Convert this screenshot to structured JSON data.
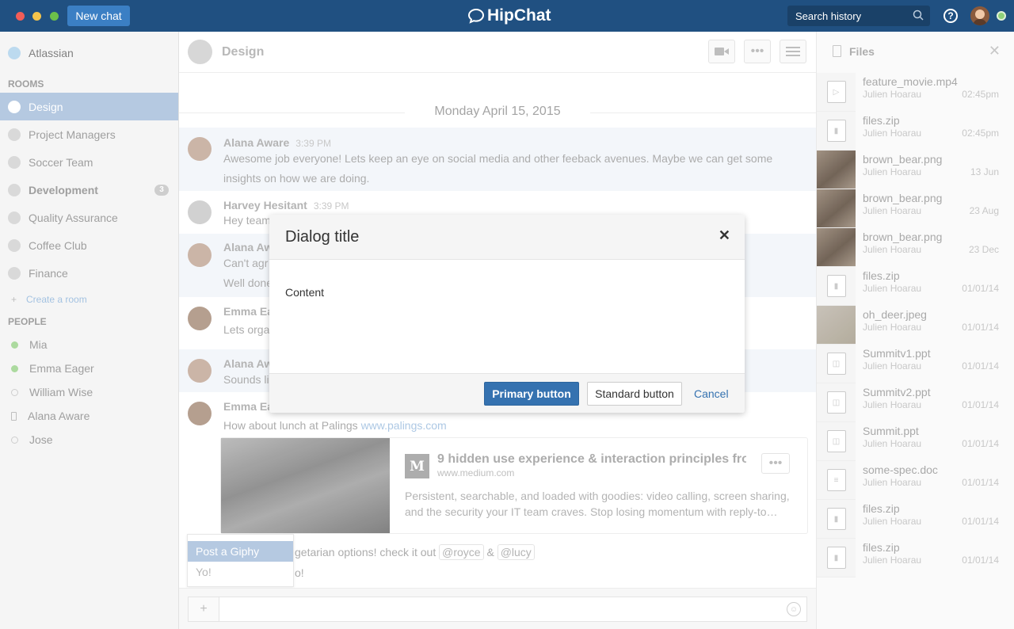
{
  "header": {
    "new_chat": "New chat",
    "logo": "HipChat",
    "search_placeholder": "Search history"
  },
  "sidebar": {
    "team": "Atlassian",
    "rooms_heading": "ROOMS",
    "rooms": [
      {
        "label": "Design",
        "active": true
      },
      {
        "label": "Project Managers"
      },
      {
        "label": "Soccer Team"
      },
      {
        "label": "Development",
        "badge": "3"
      },
      {
        "label": "Quality Assurance"
      },
      {
        "label": "Coffee Club"
      },
      {
        "label": "Finance"
      }
    ],
    "create_room": "Create a room",
    "people_heading": "PEOPLE",
    "people": [
      {
        "name": "Mia",
        "status": "online"
      },
      {
        "name": "Emma Eager",
        "status": "online"
      },
      {
        "name": "William Wise",
        "status": "offline"
      },
      {
        "name": "Alana Aware",
        "status": "mobile"
      },
      {
        "name": "Jose",
        "status": "offline"
      }
    ]
  },
  "room": {
    "title": "Design"
  },
  "chat": {
    "date": "Monday April 15, 2015",
    "messages": [
      {
        "name": "Alana Aware",
        "time": "3:39 PM",
        "text": "Awesome job everyone! Lets keep an eye on social media and other feeback avenues. Maybe we can get some insights on how we are doing."
      },
      {
        "name": "Harvey Hesitant",
        "time": "3:39 PM",
        "text": "Hey team"
      },
      {
        "name": "Alana Aw",
        "text": "Can't agr",
        "text2": "Well done"
      },
      {
        "name": "Emma Ea",
        "text": "Lets orga"
      },
      {
        "name": "Alana Aw",
        "text": "Sounds li"
      },
      {
        "name": "Emma Ea",
        "text": "How about lunch at Palings ",
        "link": "www.palings.com"
      }
    ],
    "card": {
      "logo": "M",
      "title": "9 hidden use experience & interaction principles fro",
      "site": "www.medium.com",
      "desc": "Persistent, searchable, and loaded with goodies: video calling, screen sharing, and the security your IT team craves. Stop losing momentum with reply-to…"
    },
    "last_line": "getarian options! check it out",
    "mention1": "@royce",
    "amp": "&",
    "mention2": "@lucy",
    "last_line2": "o!"
  },
  "giphy": {
    "items": [
      "Post a Giphy",
      "Yo!"
    ]
  },
  "files": {
    "title": "Files",
    "items": [
      {
        "name": "feature_movie.mp4",
        "author": "Julien Hoarau",
        "date": "02:45pm",
        "type": "video"
      },
      {
        "name": "files.zip",
        "author": "Julien Hoarau",
        "date": "02:45pm",
        "type": "zip"
      },
      {
        "name": "brown_bear.png",
        "author": "Julien Hoarau",
        "date": "13 Jun",
        "type": "photo"
      },
      {
        "name": "brown_bear.png",
        "author": "Julien Hoarau",
        "date": "23 Aug",
        "type": "photo"
      },
      {
        "name": "brown_bear.png",
        "author": "Julien Hoarau",
        "date": "23 Dec",
        "type": "photo"
      },
      {
        "name": "files.zip",
        "author": "Julien Hoarau",
        "date": "01/01/14",
        "type": "zip"
      },
      {
        "name": "oh_deer.jpeg",
        "author": "Julien Hoarau",
        "date": "01/01/14",
        "type": "deer"
      },
      {
        "name": "Summitv1.ppt",
        "author": "Julien Hoarau",
        "date": "01/01/14",
        "type": "ppt"
      },
      {
        "name": "Summitv2.ppt",
        "author": "Julien Hoarau",
        "date": "01/01/14",
        "type": "ppt"
      },
      {
        "name": "Summit.ppt",
        "author": "Julien Hoarau",
        "date": "01/01/14",
        "type": "ppt"
      },
      {
        "name": "some-spec.doc",
        "author": "Julien Hoarau",
        "date": "01/01/14",
        "type": "doc"
      },
      {
        "name": "files.zip",
        "author": "Julien Hoarau",
        "date": "01/01/14",
        "type": "zip"
      },
      {
        "name": "files.zip",
        "author": "Julien Hoarau",
        "date": "01/01/14",
        "type": "zip"
      }
    ]
  },
  "dialog": {
    "title": "Dialog title",
    "content": "Content",
    "primary": "Primary button",
    "standard": "Standard button",
    "cancel": "Cancel"
  }
}
